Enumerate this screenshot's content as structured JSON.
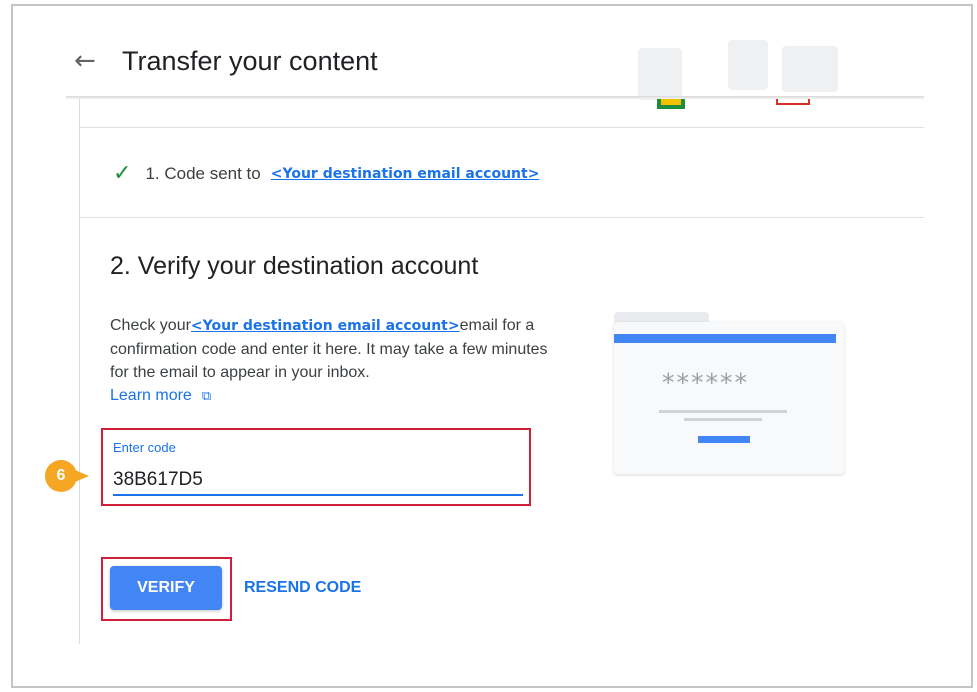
{
  "header": {
    "title": "Transfer your content"
  },
  "step1": {
    "text": "1. Code sent to",
    "email_link": "<Your destination email account>"
  },
  "step2": {
    "title": "2. Verify your destination account",
    "desc_prefix": "Check your",
    "email_link": "<Your destination email account>",
    "desc_suffix": "email for a confirmation code and enter it here. It may take a few minutes for the email to appear in your inbox.",
    "learn_more": "Learn more"
  },
  "code_field": {
    "label": "Enter code",
    "value": "38B617D5"
  },
  "annotation": {
    "step_number": "6"
  },
  "illustration": {
    "masked_code": "******"
  },
  "buttons": {
    "verify": "VERIFY",
    "resend": "RESEND CODE"
  },
  "colors": {
    "accent_blue": "#1a73e8",
    "button_blue": "#4285f4",
    "highlight_red": "#d11f3a",
    "badge_orange": "#f5a623",
    "check_green": "#1e8e3e"
  }
}
